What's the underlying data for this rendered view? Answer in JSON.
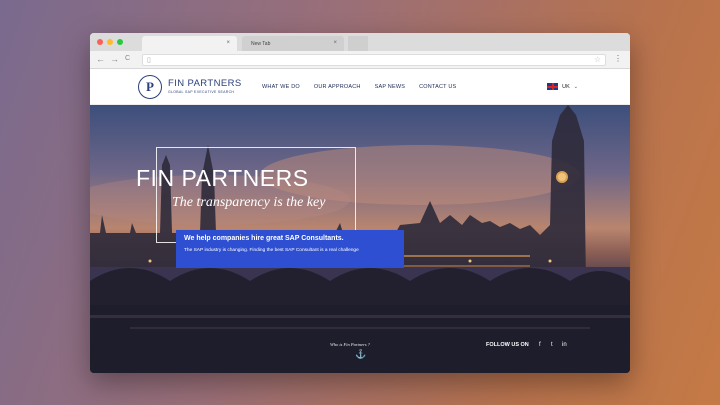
{
  "browser": {
    "tabs": [
      {
        "label": "",
        "close": "×"
      },
      {
        "label": "New Tab",
        "close": "×"
      }
    ],
    "nav": {
      "back": "←",
      "forward": "→",
      "reload": "C"
    },
    "omnibox_icon": "page-icon",
    "star": "☆",
    "menu": "⋮"
  },
  "site": {
    "brand": {
      "name": "FIN PARTNERS",
      "tagline": "GLOBAL SAP EXECUTIVE SEARCH",
      "logo_letter": "P"
    },
    "nav": [
      "WHAT WE DO",
      "OUR APPROACH",
      "SAP NEWS",
      "CONTACT US"
    ],
    "language": {
      "label": "UK",
      "caret": "⌄"
    },
    "hero": {
      "title": "FIN PARTNERS",
      "subtitle": "The transparency is the key",
      "box_heading": "We help companies hire great SAP Consultants.",
      "box_body": "The SAP industry is changing. Finding the best SAP Consultant is a real challenge",
      "who_link": "Who is Fin Partners ?",
      "anchor_icon": "⚓",
      "follow_label": "FOLLOW US ON",
      "social": [
        "f",
        "t",
        "in"
      ]
    }
  },
  "colors": {
    "brand": "#2c3f7a",
    "accent_box": "#2e4fd2"
  }
}
